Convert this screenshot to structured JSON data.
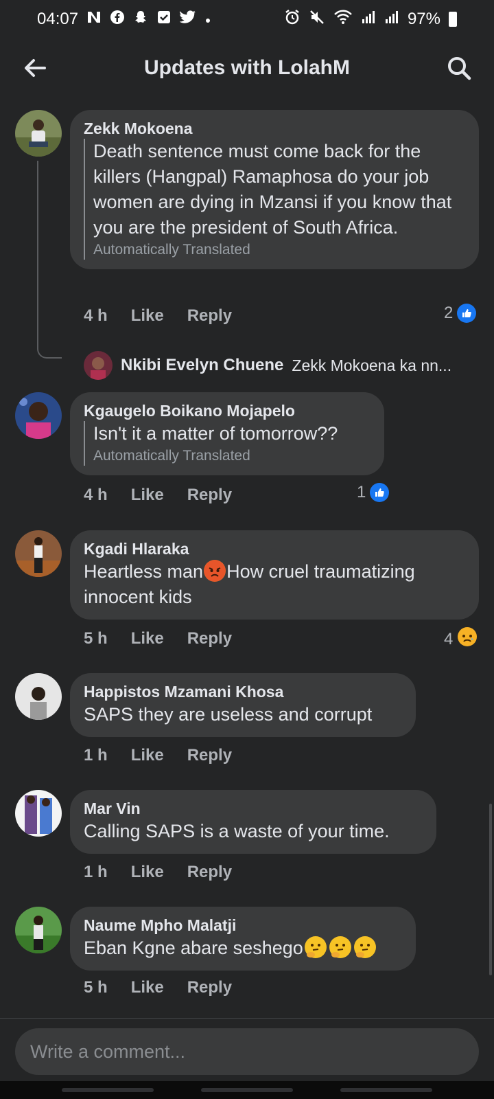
{
  "status_bar": {
    "time": "04:07",
    "battery": "97%",
    "left_icons": [
      "n-icon",
      "facebook-icon",
      "snapchat-icon",
      "checkbox-icon",
      "twitter-icon",
      "dot-icon"
    ],
    "right_icons": [
      "alarm-icon",
      "mute-icon",
      "wifi-icon",
      "signal-icon",
      "signal-icon",
      "battery-icon"
    ]
  },
  "header": {
    "title": "Updates with LolahM"
  },
  "comments": [
    {
      "author": "Zekk Mokoena",
      "text": "Death sentence must come back for the killers (Hangpal) Ramaphosa do your job women are dying in Mzansi if you know that you are the president of South Africa.",
      "translated_label": "Automatically Translated",
      "time": "4 h",
      "like": "Like",
      "reply": "Reply",
      "reaction_count": "2",
      "reaction": "like",
      "reply_preview": {
        "name": "Nkibi Evelyn Chuene",
        "snippet": "Zekk Mokoena ka  nn..."
      }
    },
    {
      "author": "Kgaugelo Boikano Mojapelo",
      "text": "Isn't it a matter of tomorrow??",
      "translated_label": "Automatically Translated",
      "time": "4 h",
      "like": "Like",
      "reply": "Reply",
      "reaction_count": "1",
      "reaction": "like"
    },
    {
      "author": "Kgadi Hlaraka",
      "text_before_emoji": "Heartless man",
      "text_after_emoji": "How cruel traumatizing innocent kids",
      "time": "5 h",
      "like": "Like",
      "reply": "Reply",
      "reaction_count": "4",
      "reaction": "sad"
    },
    {
      "author": "Happistos Mzamani Khosa",
      "text": "SAPS they are useless and corrupt",
      "time": "1 h",
      "like": "Like",
      "reply": "Reply"
    },
    {
      "author": "Mar Vin",
      "text": "Calling SAPS is a waste of your time.",
      "time": "1 h",
      "like": "Like",
      "reply": "Reply"
    },
    {
      "author": "Naume Mpho Malatji",
      "text": "Eban Kgne abare seshego",
      "time": "5 h",
      "like": "Like",
      "reply": "Reply"
    }
  ],
  "composer": {
    "placeholder": "Write a comment..."
  },
  "colors": {
    "background": "#242526",
    "bubble": "#3a3b3c",
    "like_blue": "#1877f2",
    "muted_text": "#b0b3b8"
  }
}
